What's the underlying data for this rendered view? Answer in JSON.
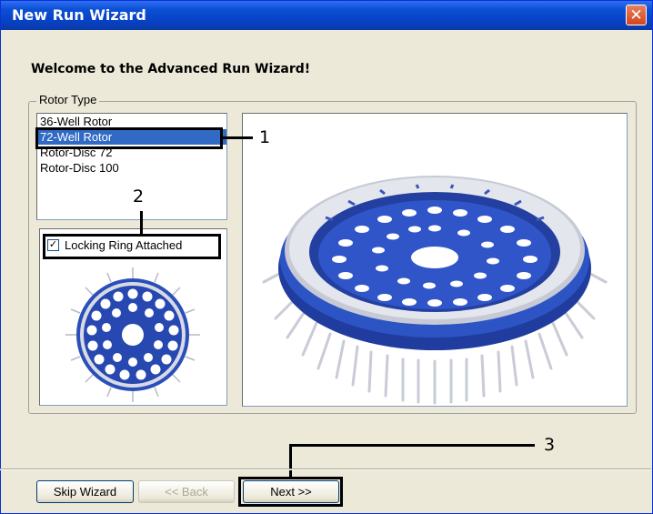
{
  "window": {
    "title": "New Run Wizard",
    "close_glyph": "✕"
  },
  "heading": "Welcome to the Advanced Run Wizard!",
  "rotor_group": {
    "legend": "Rotor Type",
    "items": [
      {
        "label": "36-Well Rotor"
      },
      {
        "label": "72-Well Rotor",
        "selected": true
      },
      {
        "label": "Rotor-Disc 72"
      },
      {
        "label": "Rotor-Disc 100"
      }
    ],
    "locking_ring": {
      "label": "Locking Ring Attached",
      "checked": true,
      "check_glyph": "✓"
    }
  },
  "callouts": {
    "one": "1",
    "two": "2",
    "three": "3"
  },
  "buttons": {
    "skip": "Skip Wizard",
    "back": "<< Back",
    "next": "Next >>"
  },
  "colors": {
    "rotor_blue": "#1f3c9e",
    "selection": "#316ac5",
    "titlebar": "#0841c4"
  }
}
